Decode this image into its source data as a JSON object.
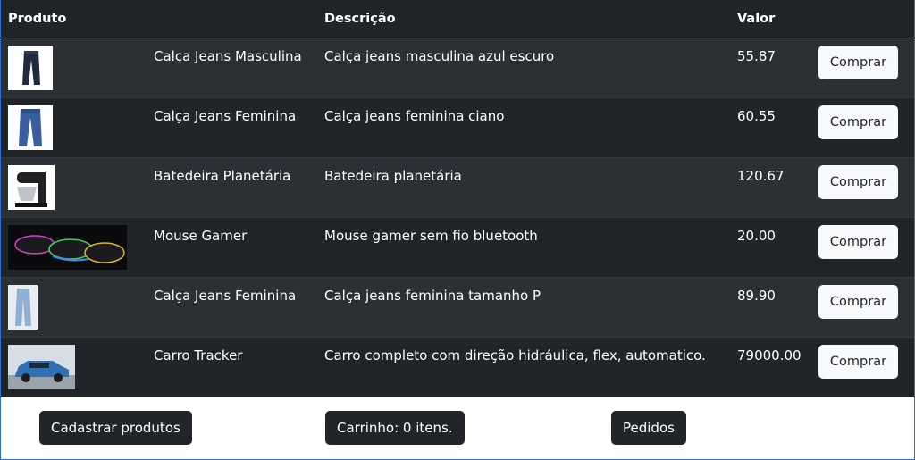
{
  "table": {
    "headers": {
      "produto": "Produto",
      "descricao": "Descrição",
      "valor": "Valor"
    },
    "buy_label": "Comprar",
    "rows": [
      {
        "nome": "Calça Jeans Masculina",
        "descricao": "Calça jeans masculina azul escuro",
        "valor": "55.87",
        "image": "dark-jeans-image"
      },
      {
        "nome": "Calça Jeans Feminina",
        "descricao": "Calça jeans feminina ciano",
        "valor": "60.55",
        "image": "blue-jeans-image"
      },
      {
        "nome": "Batedeira Planetária",
        "descricao": "Batedeira planetária",
        "valor": "120.67",
        "image": "stand-mixer-image"
      },
      {
        "nome": "Mouse Gamer",
        "descricao": "Mouse gamer sem fio bluetooth",
        "valor": "20.00",
        "image": "gamer-mouse-image"
      },
      {
        "nome": "Calça Jeans Feminina",
        "descricao": "Calça jeans feminina tamanho P",
        "valor": "89.90",
        "image": "light-jeans-image"
      },
      {
        "nome": "Carro Tracker",
        "descricao": "Carro completo com direção hidráulica, flex, automatico.",
        "valor": "79000.00",
        "image": "blue-suv-image"
      }
    ]
  },
  "footer": {
    "cadastrar_label": "Cadastrar produtos",
    "carrinho_label": "Carrinho: 0 itens.",
    "pedidos_label": "Pedidos"
  }
}
